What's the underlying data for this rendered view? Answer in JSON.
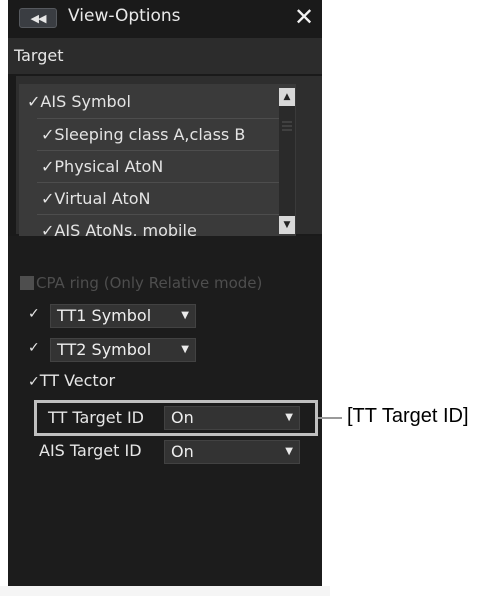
{
  "window": {
    "title": "View-Options",
    "collapse_icon": "double-chevron-left-icon",
    "close_glyph": "✕"
  },
  "section": {
    "title": "Target"
  },
  "target_list": {
    "items": [
      {
        "label": "AIS Symbol",
        "checked": true
      },
      {
        "label": "Sleeping class A,class B",
        "checked": true
      },
      {
        "label": "Physical AtoN",
        "checked": true
      },
      {
        "label": "Virtual AtoN",
        "checked": true
      },
      {
        "label": "AIS AtoNs, mobile",
        "checked": true
      }
    ]
  },
  "cpa_ring": {
    "label": "CPA ring (Only Relative mode)",
    "checked": true,
    "enabled": false
  },
  "tt1_symbol": {
    "checked": true,
    "value": "TT1 Symbol"
  },
  "tt2_symbol": {
    "checked": true,
    "value": "TT2 Symbol"
  },
  "tt_vector": {
    "label": "TT Vector",
    "checked": true
  },
  "tt_target_id": {
    "label": "TT Target ID",
    "value": "On"
  },
  "ais_target_id": {
    "label": "AIS Target ID",
    "value": "On"
  },
  "callout": {
    "text": "[TT Target ID]"
  },
  "glyphs": {
    "check": "✓",
    "dropdown": "▼",
    "scroll_up": "▲",
    "scroll_down": "▼"
  },
  "colors": {
    "panel_bg": "#1a1a1a",
    "list_bg": "#3a3a3a",
    "text": "#e6e6e6",
    "disabled_text": "#4e4e4e",
    "highlight_border": "#c0c0c0"
  }
}
